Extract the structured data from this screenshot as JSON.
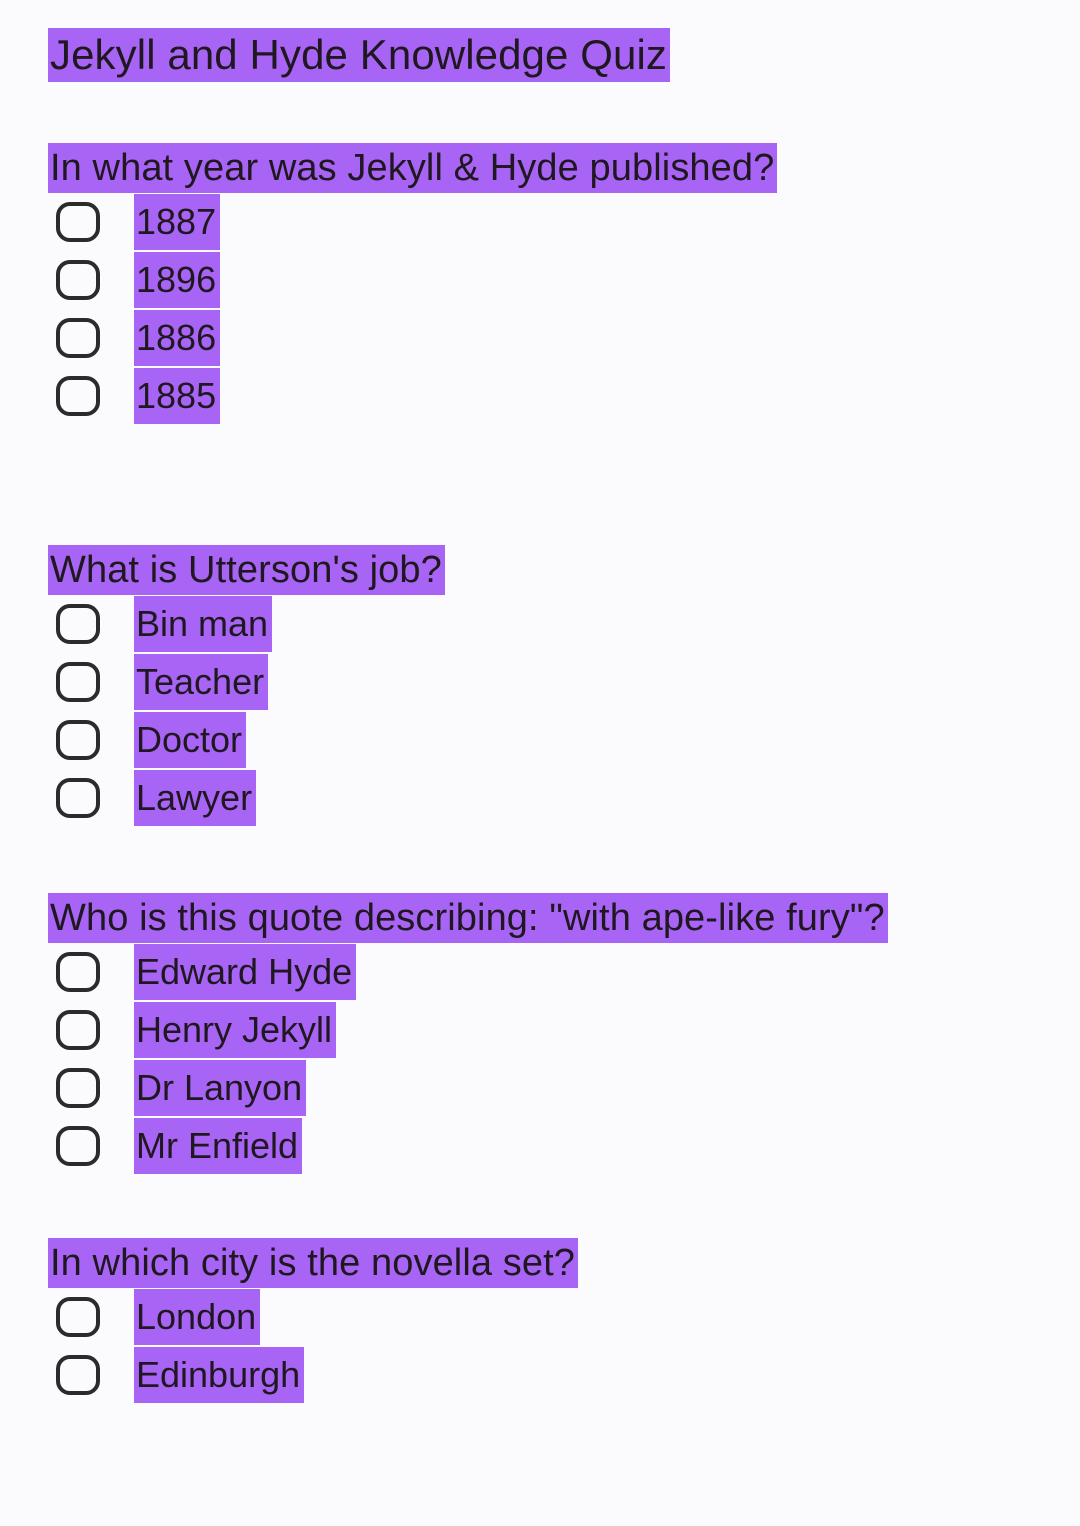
{
  "page": {
    "background_color": "#fbfafc",
    "text_color": "#201820",
    "highlight_color": "#a864f5"
  },
  "title": "Jekyll and Hyde Knowledge Quiz",
  "questions": [
    {
      "id": "q1",
      "text": "In what year was Jekyll & Hyde published?",
      "options": [
        {
          "label": "1887",
          "selected": false
        },
        {
          "label": "1896",
          "selected": false
        },
        {
          "label": "1886",
          "selected": false
        },
        {
          "label": "1885",
          "selected": false
        }
      ]
    },
    {
      "id": "q2",
      "text": "What is Utterson's job?",
      "options": [
        {
          "label": "Bin man",
          "selected": false
        },
        {
          "label": "Teacher",
          "selected": false
        },
        {
          "label": "Doctor",
          "selected": false
        },
        {
          "label": "Lawyer",
          "selected": false
        }
      ]
    },
    {
      "id": "q3",
      "text": "Who is this quote describing: \"with ape-like fury\"?",
      "options": [
        {
          "label": "Edward Hyde",
          "selected": false
        },
        {
          "label": "Henry Jekyll",
          "selected": false
        },
        {
          "label": "Dr Lanyon",
          "selected": false
        },
        {
          "label": "Mr Enfield",
          "selected": false
        }
      ]
    },
    {
      "id": "q4",
      "text": "In which city is the novella set?",
      "options": [
        {
          "label": "London",
          "selected": false
        },
        {
          "label": "Edinburgh",
          "selected": false
        }
      ]
    }
  ]
}
